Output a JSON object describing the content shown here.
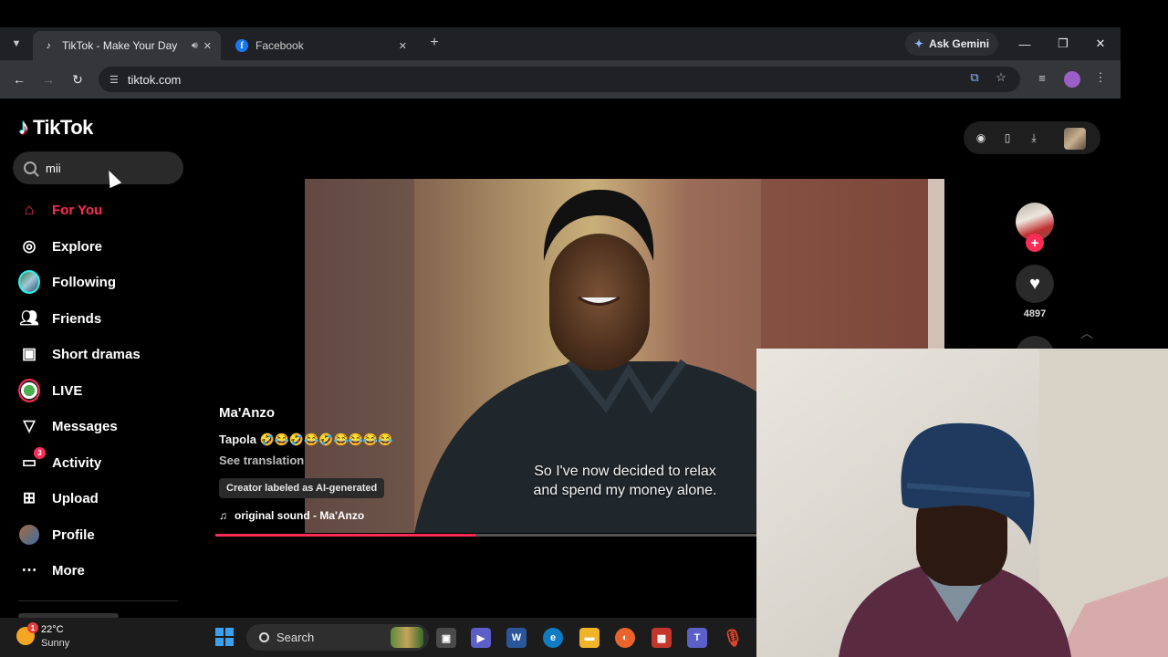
{
  "browser": {
    "tabs": [
      {
        "title": "TikTok - Make Your Day",
        "active": true
      },
      {
        "title": "Facebook",
        "active": false
      }
    ],
    "gemini_label": "Ask Gemini",
    "url": "tiktok.com"
  },
  "tiktok": {
    "logo_text": "TikTok",
    "search_value": "mii",
    "nav": [
      {
        "label": "For You",
        "icon": "home-icon",
        "active": true
      },
      {
        "label": "Explore",
        "icon": "compass-icon",
        "active": false
      },
      {
        "label": "Following",
        "icon": "following-avatar-icon",
        "active": false
      },
      {
        "label": "Friends",
        "icon": "friends-icon",
        "active": false
      },
      {
        "label": "Short dramas",
        "icon": "film-icon",
        "active": false
      },
      {
        "label": "LIVE",
        "icon": "live-icon",
        "active": false
      },
      {
        "label": "Messages",
        "icon": "send-icon",
        "active": false
      },
      {
        "label": "Activity",
        "icon": "activity-icon",
        "active": false,
        "badge": "3"
      },
      {
        "label": "Upload",
        "icon": "plus-square-icon",
        "active": false
      },
      {
        "label": "Profile",
        "icon": "profile-avatar-icon",
        "active": false
      },
      {
        "label": "More",
        "icon": "more-dots-icon",
        "active": false
      }
    ]
  },
  "video": {
    "author": "Ma'Anzo",
    "caption": "Tapola 🤣😂🤣😂🤣😂😂😂😂",
    "see_translation": "See translation",
    "ai_label": "Creator labeled as AI-generated",
    "sound": "original sound - Ma'Anzo",
    "subtitle_line1": "So I've now decided to relax",
    "subtitle_line2": "and spend my money alone.",
    "progress": 0.48,
    "like_count": "4897"
  },
  "taskbar": {
    "temperature": "22°C",
    "condition": "Sunny",
    "weather_badge": "1",
    "search_label": "Search"
  },
  "colors": {
    "accent": "#fe2c55",
    "background": "#000000",
    "chrome": "#35363a"
  }
}
